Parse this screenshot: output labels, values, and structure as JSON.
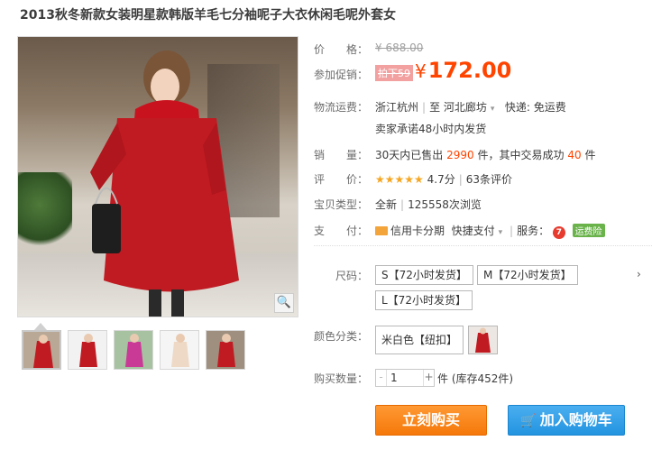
{
  "title": "2013秋冬新款女装明星款韩版羊毛七分袖呢子大衣休闲毛呢外套女",
  "price": {
    "label": "价　　格：",
    "original": "¥ 688.00"
  },
  "promo": {
    "label": "参加促销：",
    "tag": "拍下59",
    "currency": "¥",
    "value": "172.00"
  },
  "shipping": {
    "label": "物流运费：",
    "from": "浙江杭州",
    "to_prefix": "至",
    "to": "河北廊坊",
    "caret": "▾",
    "express": "快递: 免运费",
    "promise": "卖家承诺48小时内发货"
  },
  "sales": {
    "label": "销　　量：",
    "prefix": "30天内已售出",
    "count": "2990",
    "mid": "件，其中交易成功",
    "success": "40",
    "suffix": "件"
  },
  "rating": {
    "label": "评　　价：",
    "stars": "★★★★★",
    "score": "4.7分",
    "reviews": "63条评价"
  },
  "type": {
    "label": "宝贝类型：",
    "value": "全新",
    "views": "125558次浏览"
  },
  "payment": {
    "label": "支　　付：",
    "credit": "信用卡分期",
    "quick": "快捷支付",
    "service_label": "服务：",
    "service_icon": "7",
    "insurance": "运费险"
  },
  "size": {
    "label": "尺码：",
    "options": [
      "S【72小时发货】",
      "M【72小时发货】",
      "L【72小时发货】"
    ],
    "more": "›"
  },
  "color": {
    "label": "颜色分类：",
    "options": [
      "米白色【纽扣】"
    ]
  },
  "quantity": {
    "label": "购买数量：",
    "value": "1",
    "minus": "-",
    "plus": "+",
    "stock": "件 (库存452件)"
  },
  "buttons": {
    "buy": "立刻购买",
    "cart": "加入购物车"
  },
  "icons": {
    "zoom": "search-icon",
    "cart": "shopping-cart-icon",
    "card": "credit-card-icon",
    "caret": "chevron-down-icon"
  },
  "colors": {
    "accent": "#ff4400",
    "buy": "#f5780a",
    "cart": "#2394e0",
    "star": "#f5a623",
    "insurance": "#6ab34b"
  }
}
